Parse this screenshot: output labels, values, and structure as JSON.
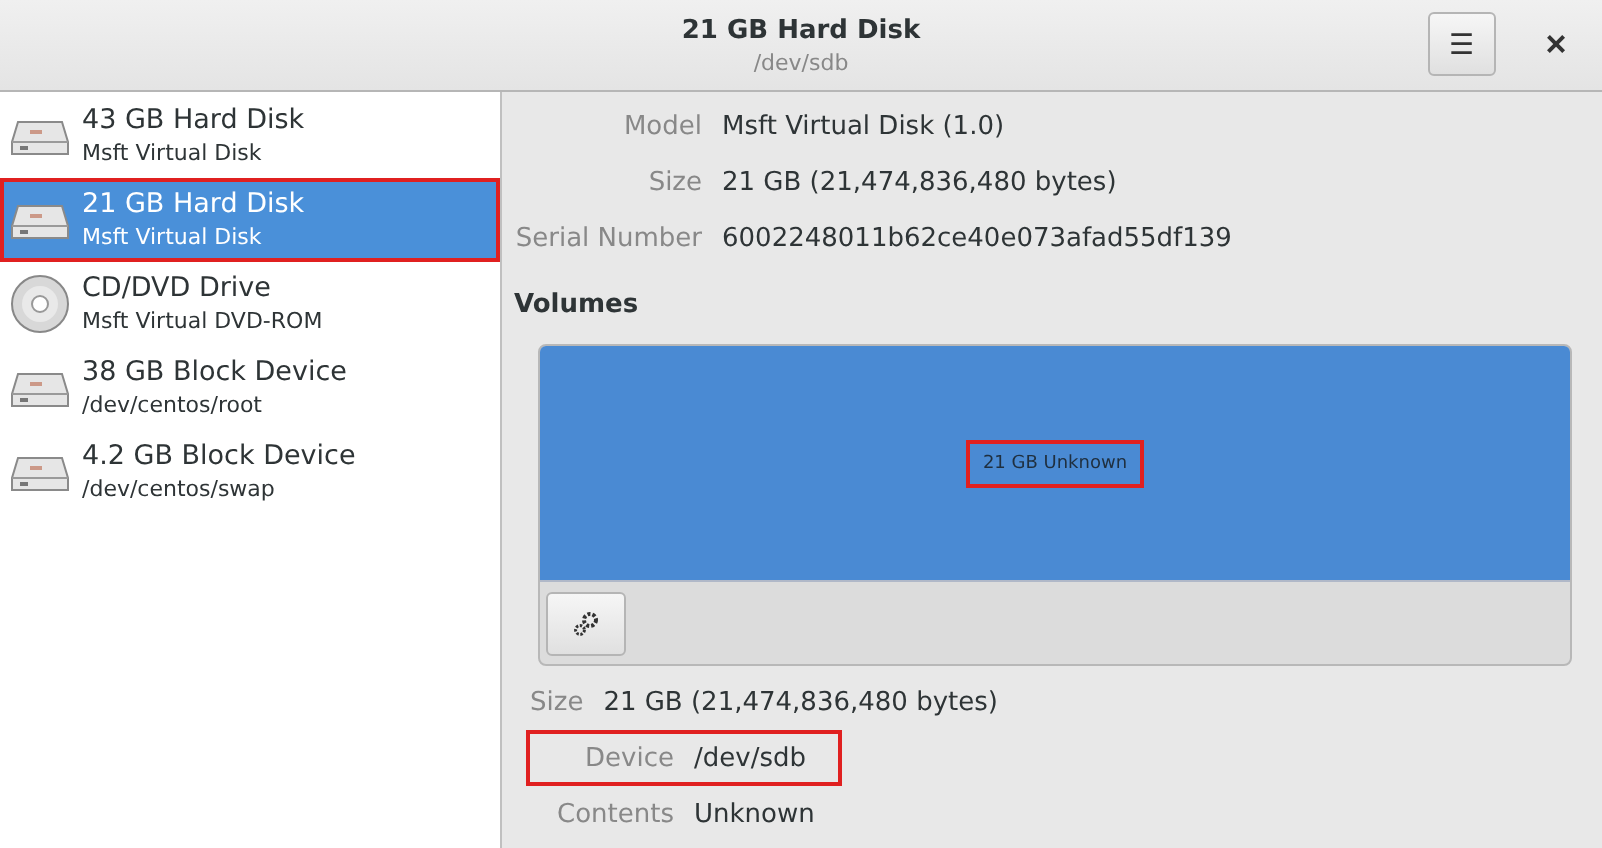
{
  "window": {
    "title": "21 GB Hard Disk",
    "subtitle": "/dev/sdb",
    "menu_button": "☰",
    "close_button": "×"
  },
  "sidebar": {
    "items": [
      {
        "kind": "disk",
        "title": "43 GB Hard Disk",
        "subtitle": "Msft Virtual Disk",
        "selected": false,
        "annotated": false
      },
      {
        "kind": "disk",
        "title": "21 GB Hard Disk",
        "subtitle": "Msft Virtual Disk",
        "selected": true,
        "annotated": true
      },
      {
        "kind": "optical",
        "title": "CD/DVD Drive",
        "subtitle": "Msft Virtual DVD-ROM",
        "selected": false,
        "annotated": false
      },
      {
        "kind": "disk",
        "title": "38 GB Block Device",
        "subtitle": "/dev/centos/root",
        "selected": false,
        "annotated": false
      },
      {
        "kind": "disk",
        "title": "4.2 GB Block Device",
        "subtitle": "/dev/centos/swap",
        "selected": false,
        "annotated": false
      }
    ]
  },
  "drive_details": [
    {
      "label": "Model",
      "value": "Msft Virtual Disk (1.0)"
    },
    {
      "label": "Size",
      "value": "21 GB (21,474,836,480 bytes)"
    },
    {
      "label": "Serial Number",
      "value": "6002248011b62ce40e073afad55df139"
    }
  ],
  "volumes": {
    "heading": "Volumes",
    "partition": {
      "label": "21 GB Unknown",
      "selected": true,
      "annotated": true
    }
  },
  "volume_details": [
    {
      "label": "Size",
      "value": "21 GB (21,474,836,480 bytes)",
      "annotated": false
    },
    {
      "label": "Device",
      "value": "/dev/sdb",
      "annotated": true
    },
    {
      "label": "Contents",
      "value": "Unknown",
      "annotated": false
    }
  ]
}
